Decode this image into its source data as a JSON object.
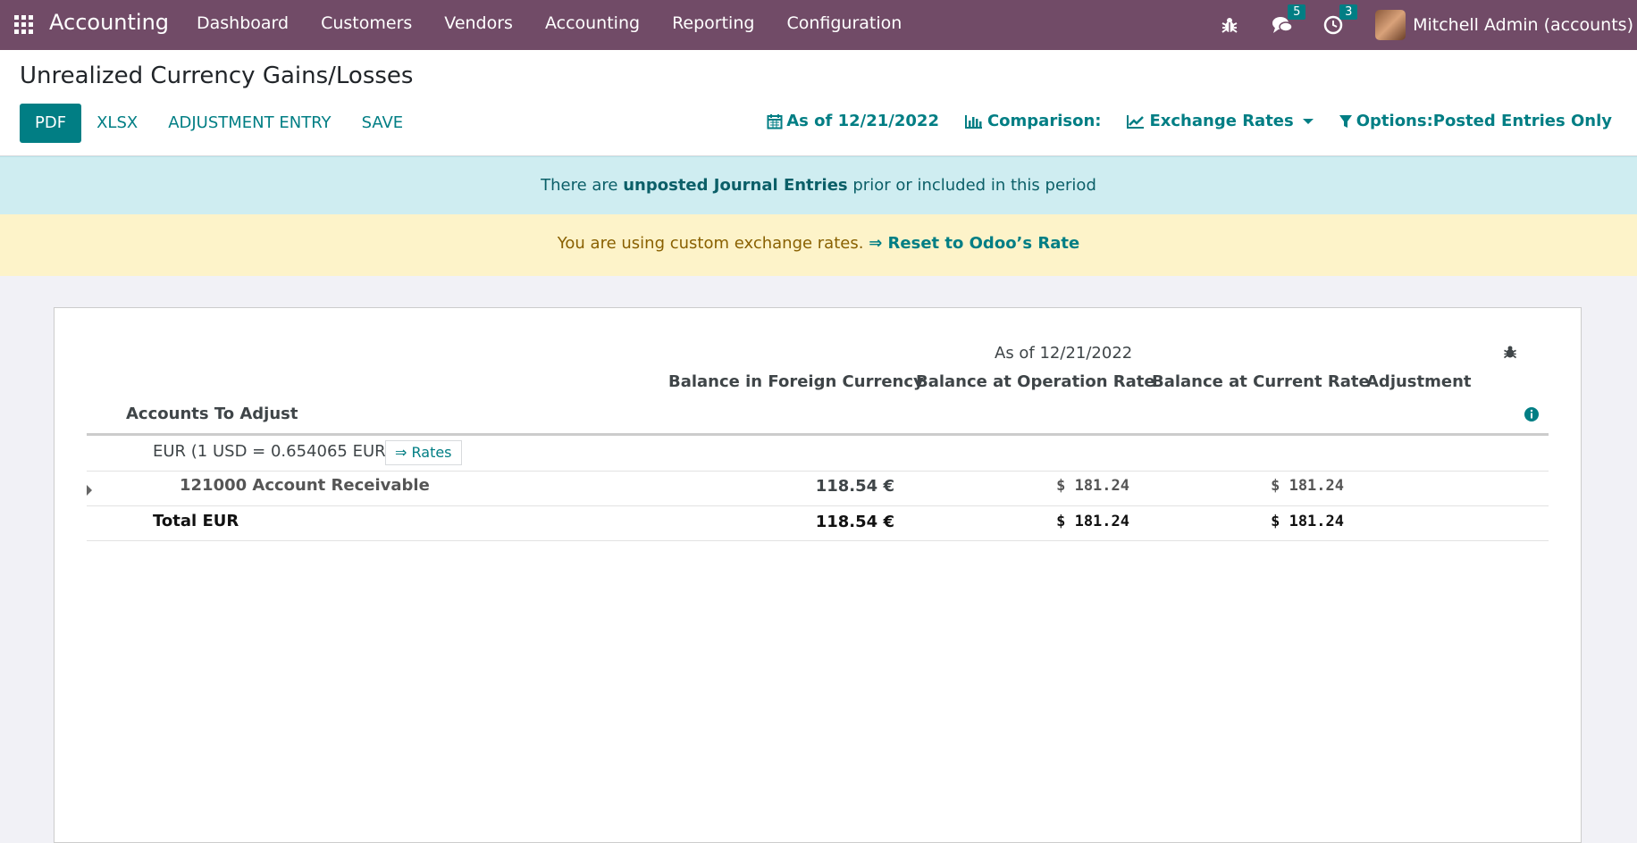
{
  "navbar": {
    "app_name": "Accounting",
    "menu": [
      "Dashboard",
      "Customers",
      "Vendors",
      "Accounting",
      "Reporting",
      "Configuration"
    ],
    "messages_count": "5",
    "activities_count": "3",
    "user": "Mitchell Admin (accounts)"
  },
  "control_panel": {
    "title": "Unrealized Currency Gains/Losses",
    "buttons": [
      "PDF",
      "XLSX",
      "ADJUSTMENT ENTRY",
      "SAVE"
    ],
    "date_filter": "As of 12/21/2022",
    "comparison": "Comparison:",
    "exchange_rates": "Exchange Rates",
    "options": "Options:Posted Entries Only"
  },
  "alerts": {
    "info_prefix": "There are",
    "info_link": "unposted Journal Entries",
    "info_suffix": "prior or included in this period",
    "warn_text": "You are using custom exchange rates.",
    "warn_link": "⇒ Reset to Odoo’s Rate"
  },
  "report": {
    "period_header": "As of 12/21/2022",
    "columns": [
      "Balance in Foreign Currency",
      "Balance at Operation Rate",
      "Balance at Current Rate",
      "Adjustment"
    ],
    "accounts_header": "Accounts To Adjust",
    "currency_group": "EUR (1 USD = 0.654065 EUR)",
    "rates_button": "⇒ Rates",
    "rows": [
      {
        "label": "121000 Account Receivable",
        "foreign": "118.54 €",
        "operation": "$ 181.24",
        "current": "$ 181.24",
        "adjustment": ""
      },
      {
        "label": "Total EUR",
        "foreign": "118.54 €",
        "operation": "$ 181.24",
        "current": "$ 181.24",
        "adjustment": ""
      }
    ]
  },
  "colors": {
    "navbar": "#714b67",
    "primary": "#017e84",
    "info_bg": "#cfedf1",
    "warning_bg": "#fdf3c9"
  }
}
